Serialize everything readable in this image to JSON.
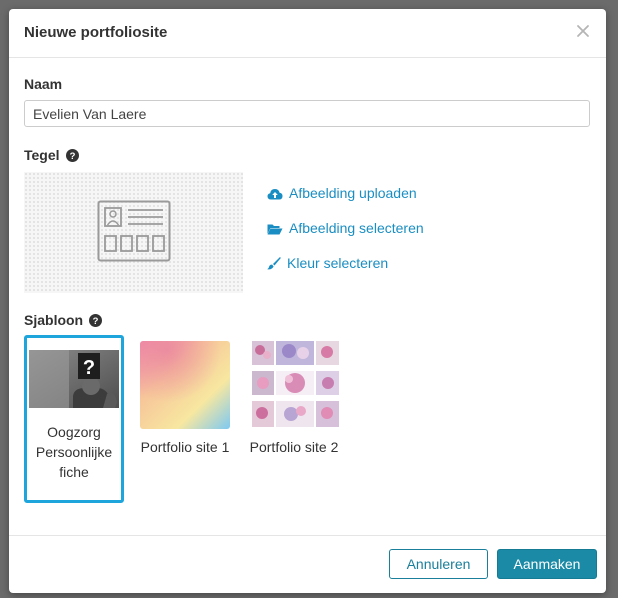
{
  "dialog": {
    "title": "Nieuwe portfoliosite",
    "close_icon": "close-icon"
  },
  "name": {
    "label": "Naam",
    "value": "Evelien Van Laere"
  },
  "tile": {
    "label": "Tegel",
    "placeholder_icon": "id-card-icon",
    "actions": {
      "upload": "Afbeelding uploaden",
      "select": "Afbeelding selecteren",
      "color": "Kleur selecteren"
    }
  },
  "template": {
    "label": "Sjabloon",
    "items": [
      {
        "name": "Oogzorg Persoonlijke fiche",
        "selected": true
      },
      {
        "name": "Portfolio site 1",
        "selected": false
      },
      {
        "name": "Portfolio site 2",
        "selected": false
      }
    ]
  },
  "footer": {
    "cancel": "Annuleren",
    "create": "Aanmaken"
  },
  "colors": {
    "accent": "#1a8ec2",
    "selected_border": "#1ea6dc",
    "primary_button": "#1a8aa6"
  }
}
